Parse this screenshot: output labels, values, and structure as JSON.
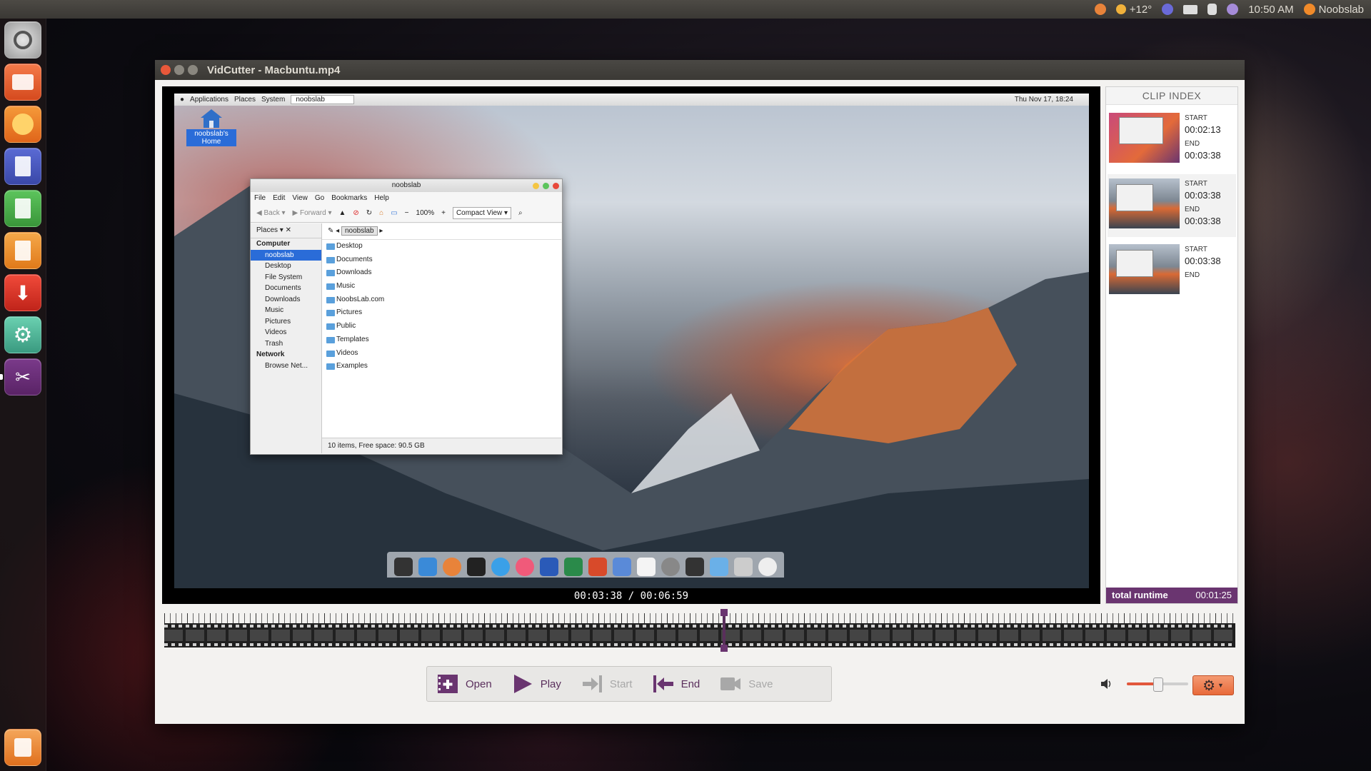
{
  "top_panel": {
    "weather_temp": "+12°",
    "clock": "10:50 AM",
    "user": "Noobslab"
  },
  "window": {
    "title": "VidCutter - Macbuntu.mp4"
  },
  "video_frame": {
    "menu": [
      "Applications",
      "Places",
      "System"
    ],
    "location_field": "noobslab",
    "datetime": "Thu Nov 17, 18:24",
    "desktop_icon_label": "noobslab's Home",
    "file_manager": {
      "title": "noobslab",
      "menu": [
        "File",
        "Edit",
        "View",
        "Go",
        "Bookmarks",
        "Help"
      ],
      "back": "Back",
      "forward": "Forward",
      "zoom": "100%",
      "view_mode": "Compact View",
      "places_label": "Places",
      "path_button": "noobslab",
      "sidebar": [
        {
          "label": "Computer",
          "header": true
        },
        {
          "label": "noobslab",
          "selected": true
        },
        {
          "label": "Desktop"
        },
        {
          "label": "File System"
        },
        {
          "label": "Documents"
        },
        {
          "label": "Downloads"
        },
        {
          "label": "Music"
        },
        {
          "label": "Pictures"
        },
        {
          "label": "Videos"
        },
        {
          "label": "Trash"
        },
        {
          "label": "Network",
          "header": true
        },
        {
          "label": "Browse Net..."
        }
      ],
      "folders": [
        "Desktop",
        "Documents",
        "Downloads",
        "Music",
        "NoobsLab.com",
        "Pictures",
        "Public",
        "Templates",
        "Videos",
        "Examples"
      ],
      "status": "10 items, Free space: 90.5 GB"
    }
  },
  "timecode": "00:03:38 / 00:06:59",
  "clip_index": {
    "header": "CLIP INDEX",
    "start_label": "START",
    "end_label": "END",
    "clips": [
      {
        "start": "00:02:13",
        "end": "00:03:38"
      },
      {
        "start": "00:03:38",
        "end": "00:03:38"
      },
      {
        "start": "00:03:38",
        "end": ""
      }
    ],
    "total_label": "total runtime",
    "total_value": "00:01:25"
  },
  "timeline": {
    "position_fraction": 0.521
  },
  "toolbar": {
    "open": "Open",
    "play": "Play",
    "start": "Start",
    "end": "End",
    "save": "Save"
  },
  "volume": {
    "level_fraction": 0.5
  },
  "colors": {
    "accent": "#6a3570",
    "orange": "#e86a3a"
  }
}
